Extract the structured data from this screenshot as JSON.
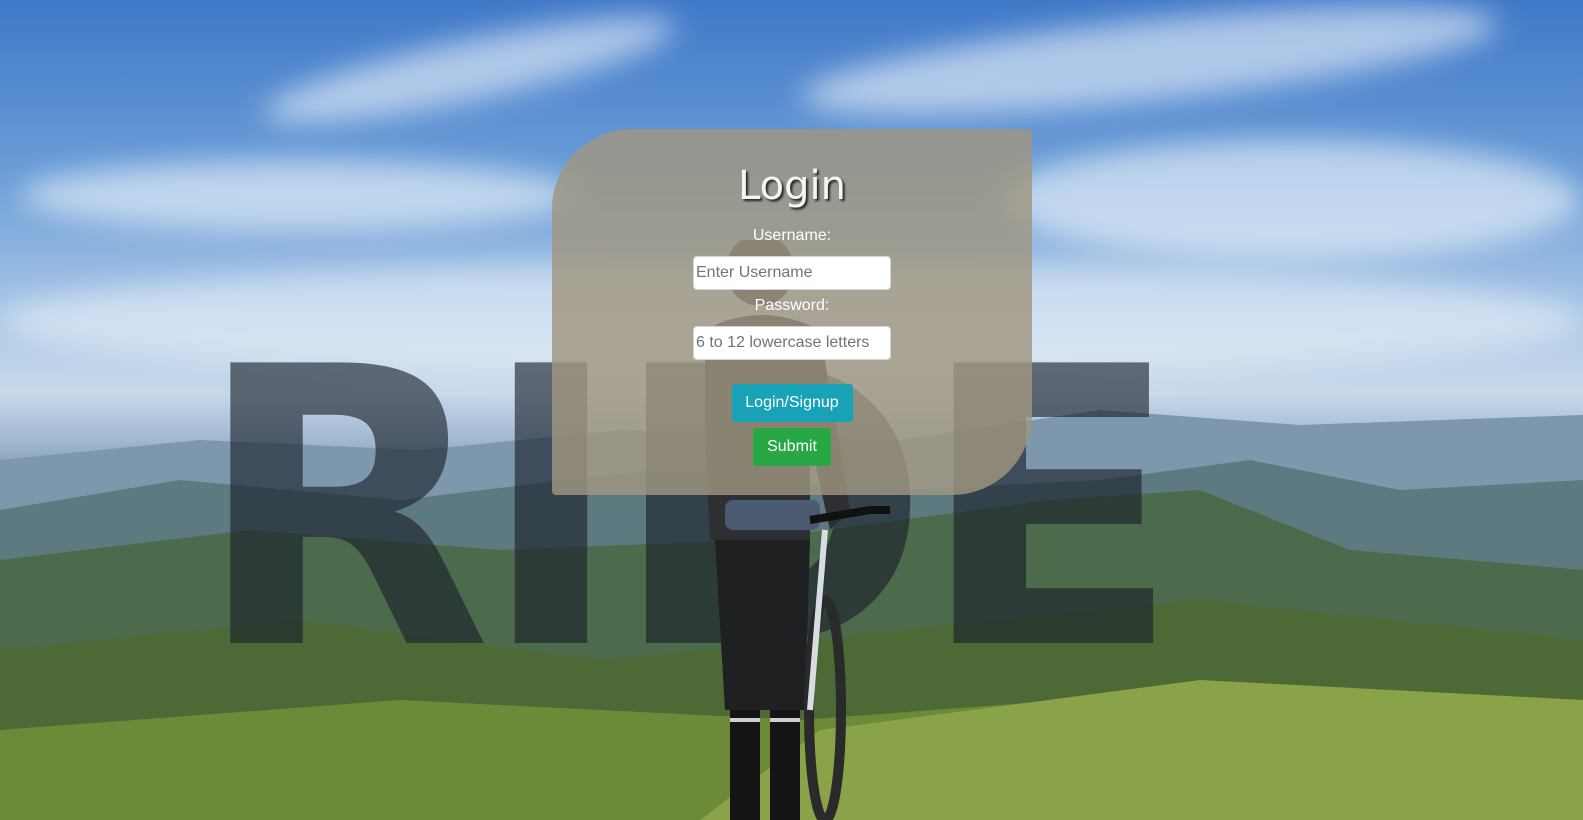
{
  "background": {
    "watermark_text": "RIDE",
    "description_icon": "mountain-cyclist-photo"
  },
  "login": {
    "title": "Login",
    "username_label": "Username:",
    "username_placeholder": "Enter Username",
    "password_label": "Password:",
    "password_placeholder": "6 to 12 lowercase letters",
    "login_signup_label": "Login/Signup",
    "submit_label": "Submit"
  },
  "colors": {
    "card_bg": "#a09680",
    "login_button": "#17a2b8",
    "submit_button": "#28a745"
  }
}
